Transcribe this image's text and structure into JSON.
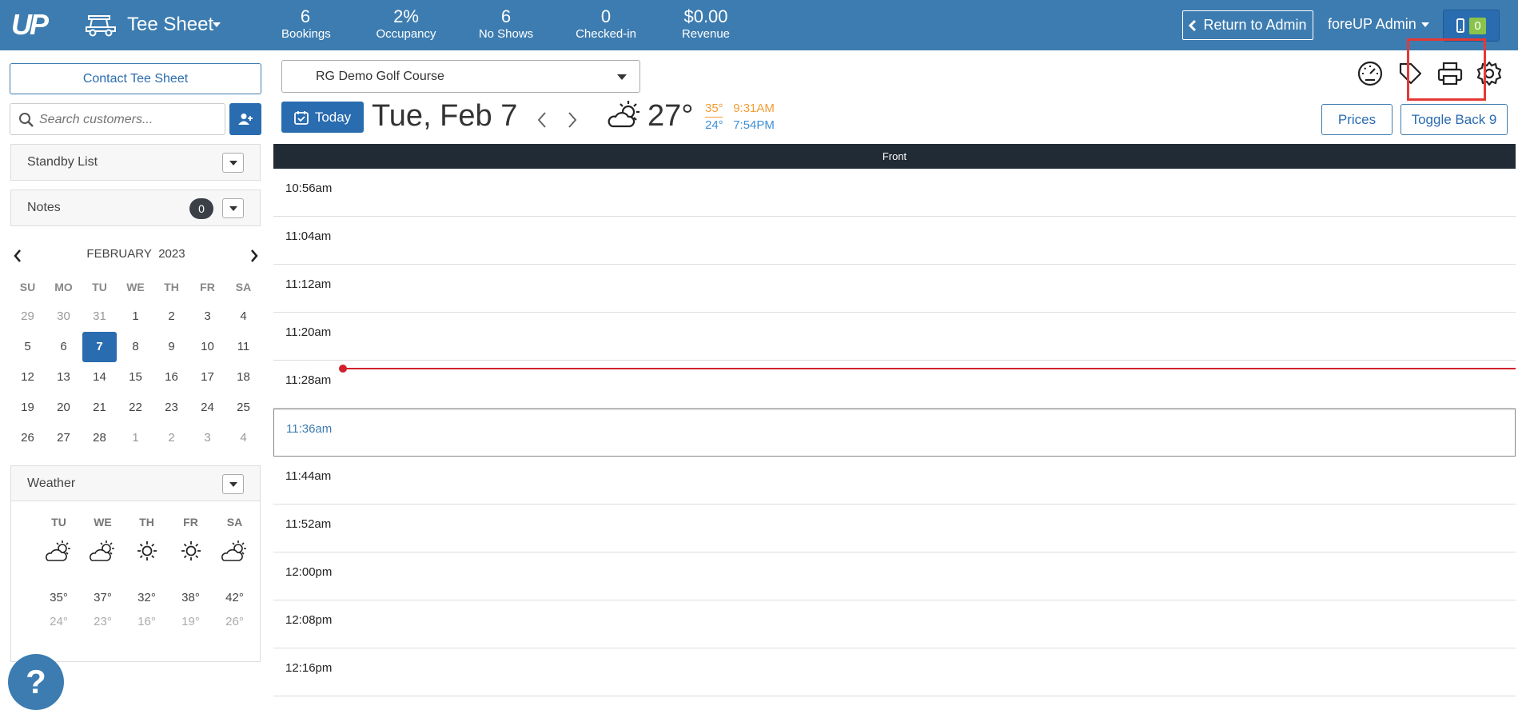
{
  "header": {
    "logo": "UP",
    "app_title": "Tee Sheet",
    "stats": [
      {
        "value": "6",
        "label": "Bookings"
      },
      {
        "value": "2%",
        "label": "Occupancy"
      },
      {
        "value": "6",
        "label": "No Shows"
      },
      {
        "value": "0",
        "label": "Checked-in"
      },
      {
        "value": "$0.00",
        "label": "Revenue"
      }
    ],
    "return_label": "Return to Admin",
    "admin_label": "foreUP Admin",
    "mobile_count": "0"
  },
  "sidebar": {
    "contact_label": "Contact Tee Sheet",
    "search_placeholder": "Search customers...",
    "standby_label": "Standby List",
    "notes_label": "Notes",
    "notes_count": "0",
    "calendar": {
      "month": "FEBRUARY",
      "year": "2023",
      "dow": [
        "SU",
        "MO",
        "TU",
        "WE",
        "TH",
        "FR",
        "SA"
      ],
      "days": [
        [
          "29",
          "30",
          "31",
          "1",
          "2",
          "3",
          "4"
        ],
        [
          "5",
          "6",
          "7",
          "8",
          "9",
          "10",
          "11"
        ],
        [
          "12",
          "13",
          "14",
          "15",
          "16",
          "17",
          "18"
        ],
        [
          "19",
          "20",
          "21",
          "22",
          "23",
          "24",
          "25"
        ],
        [
          "26",
          "27",
          "28",
          "1",
          "2",
          "3",
          "4"
        ]
      ],
      "selected": "7"
    },
    "weather": {
      "label": "Weather",
      "days": [
        {
          "day": "TU",
          "icon": "partly-cloudy-icon",
          "hi": "35°",
          "lo": "24°"
        },
        {
          "day": "WE",
          "icon": "partly-cloudy-icon",
          "hi": "37°",
          "lo": "23°"
        },
        {
          "day": "TH",
          "icon": "sunny-icon",
          "hi": "32°",
          "lo": "16°"
        },
        {
          "day": "FR",
          "icon": "sunny-icon",
          "hi": "38°",
          "lo": "19°"
        },
        {
          "day": "SA",
          "icon": "partly-cloudy-icon",
          "hi": "42°",
          "lo": "26°"
        }
      ]
    },
    "help_label": "?"
  },
  "main": {
    "course": "RG Demo Golf Course",
    "today_label": "Today",
    "date": "Tue, Feb 7",
    "current_temp": "27°",
    "hi_temp": "35°",
    "lo_temp": "24°",
    "sunrise": "9:31AM",
    "sunset": "7:54PM",
    "prices_label": "Prices",
    "toggle_label": "Toggle Back 9",
    "sheet_header": "Front",
    "times": [
      "10:56am",
      "11:04am",
      "11:12am",
      "11:20am",
      "11:28am",
      "11:36am",
      "11:44am",
      "11:52am",
      "12:00pm",
      "12:08pm",
      "12:16pm"
    ],
    "active_time": "11:36am"
  },
  "colors": {
    "brand": "#3d7cb0",
    "primary": "#2a6cb0",
    "now_line": "#d0212c",
    "highlight": "#e53935"
  }
}
